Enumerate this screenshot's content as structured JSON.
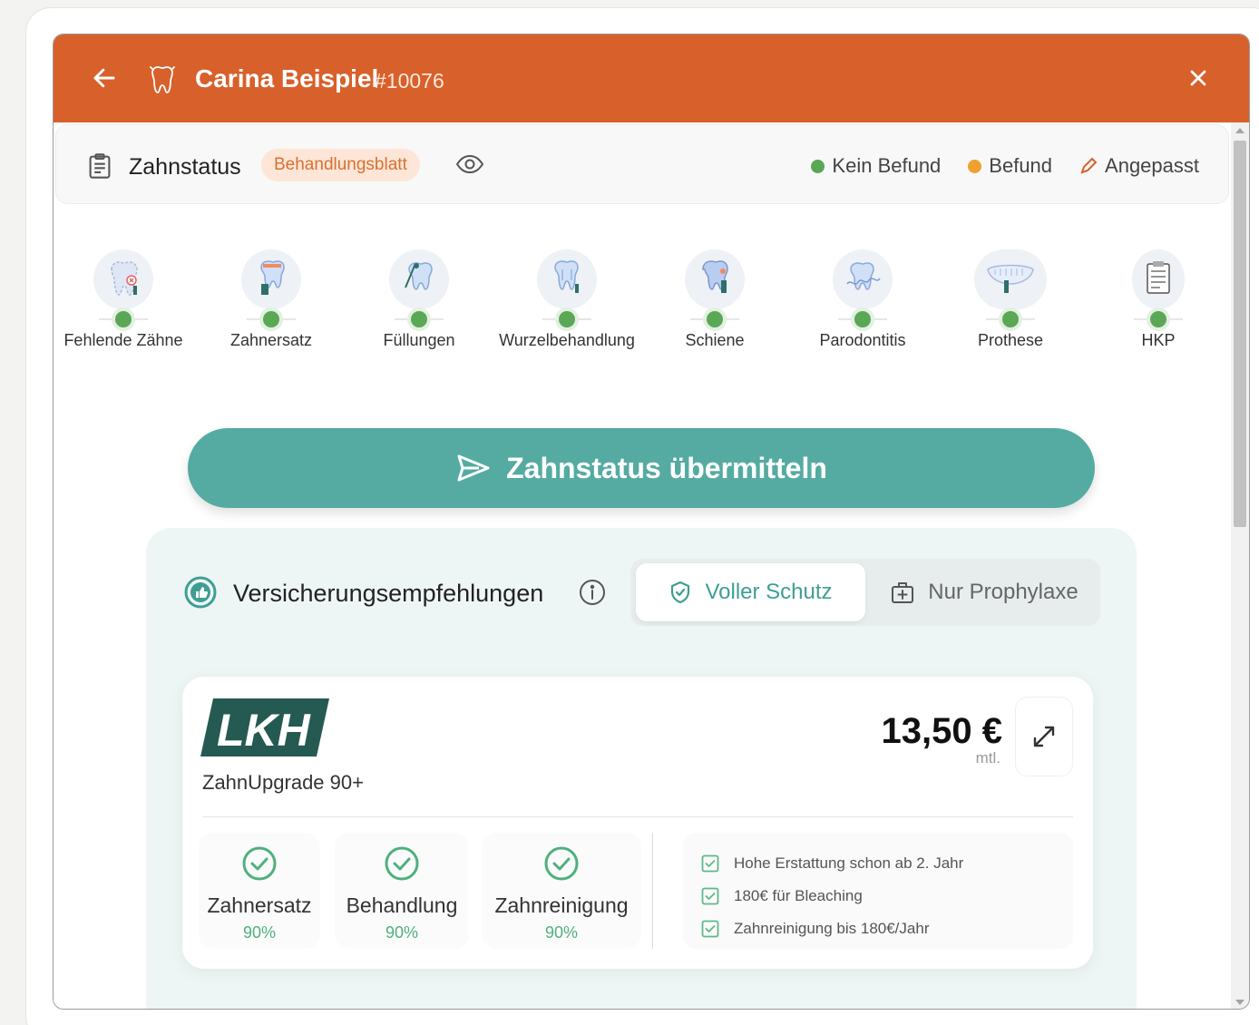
{
  "header": {
    "patient_name": "Carina Beispiel",
    "patient_id": "#10076",
    "bg_color": "#d8602a"
  },
  "status_bar": {
    "title": "Zahnstatus",
    "badge": "Behandlungsblatt",
    "legend": [
      {
        "label": "Kein Befund",
        "color": "#5aa756"
      },
      {
        "label": "Befund",
        "color": "#f0a02f"
      },
      {
        "label": "Angepasst",
        "color": "#d8602a"
      }
    ]
  },
  "categories": [
    {
      "label": "Fehlende Zähne",
      "icon": "missing-tooth-icon"
    },
    {
      "label": "Zahnersatz",
      "icon": "denture-icon"
    },
    {
      "label": "Füllungen",
      "icon": "filling-icon"
    },
    {
      "label": "Wurzelbehandlung",
      "icon": "root-canal-icon"
    },
    {
      "label": "Schiene",
      "icon": "splint-icon"
    },
    {
      "label": "Parodontitis",
      "icon": "gum-icon"
    },
    {
      "label": "Prothese",
      "icon": "prosthesis-icon"
    },
    {
      "label": "HKP",
      "icon": "treatment-plan-icon"
    }
  ],
  "submit": {
    "label": "Zahnstatus übermitteln",
    "color": "#55aba2"
  },
  "insurance": {
    "title": "Versicherungsempfehlungen",
    "segments": {
      "active": "Voller Schutz",
      "inactive": "Nur Prophylaxe"
    },
    "card": {
      "logo": "LKH",
      "tariff": "ZahnUpgrade 90+",
      "price": "13,50 €",
      "price_unit": "mtl.",
      "coverage": [
        {
          "label": "Zahnersatz",
          "pct": "90%"
        },
        {
          "label": "Behandlung",
          "pct": "90%"
        },
        {
          "label": "Zahnreinigung",
          "pct": "90%"
        }
      ],
      "features": [
        "Hohe Erstattung schon ab 2. Jahr",
        "180€ für Bleaching",
        "Zahnreinigung bis 180€/Jahr"
      ]
    }
  }
}
